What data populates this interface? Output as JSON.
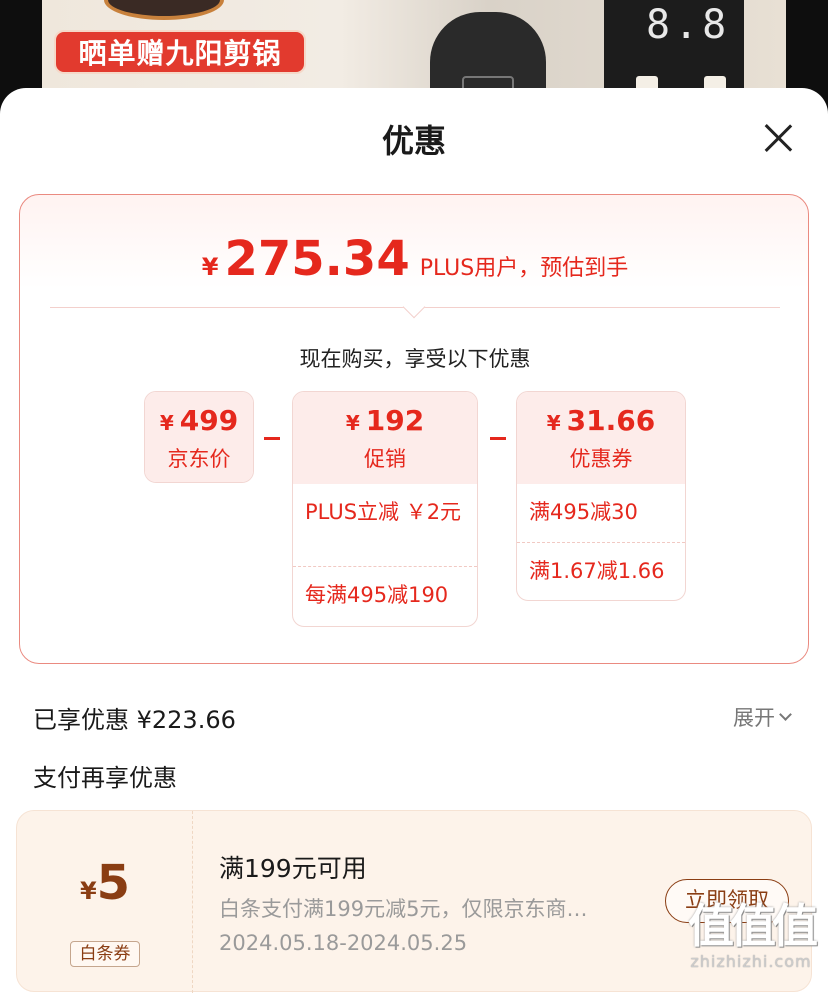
{
  "background": {
    "promo_banner": "晒单赠九阳剪锅",
    "display_digits": "8.8"
  },
  "sheet": {
    "title": "优惠",
    "close_icon": "close-icon"
  },
  "estimate": {
    "currency": "¥",
    "price": "275.34",
    "subtitle": "PLUS用户，预估到手",
    "buy_text": "现在购买，享受以下优惠"
  },
  "breakdown": {
    "jd_price": {
      "currency": "¥",
      "amount": "499",
      "label": "京东价"
    },
    "promotion": {
      "currency": "¥",
      "amount": "192",
      "label": "促销",
      "rows": [
        "PLUS立减 ￥2元",
        "每满495减190"
      ]
    },
    "coupon": {
      "currency": "¥",
      "amount": "31.66",
      "label": "优惠券",
      "rows": [
        "满495减30",
        "满1.67减1.66"
      ]
    }
  },
  "enjoyed": {
    "text": "已享优惠 ¥223.66",
    "expand_label": "展开"
  },
  "pay": {
    "title": "支付再享优惠"
  },
  "baitiao_coupon": {
    "currency": "¥",
    "amount": "5",
    "tag": "白条券",
    "title": "满199元可用",
    "description": "白条支付满199元减5元，仅限京东商…",
    "date_range": "2024.05.18-2024.05.25",
    "button": "立即领取"
  },
  "watermark": {
    "glyphs": "值值值",
    "url": "zhizhizhi.com"
  },
  "colors": {
    "accent_red": "#e5281d",
    "coupon_brown": "#8a3d13",
    "coupon_bg": "#fdf3ea"
  }
}
